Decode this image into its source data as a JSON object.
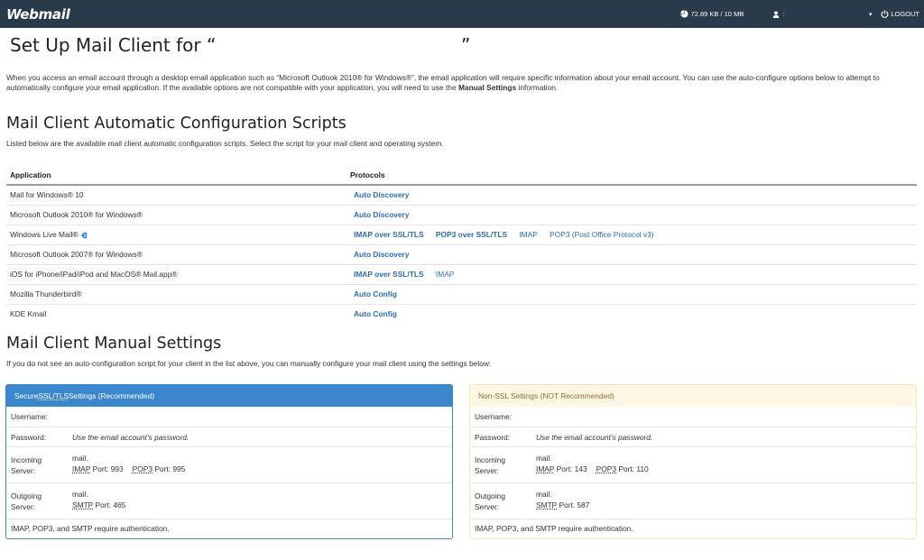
{
  "header": {
    "logo": "Webmail",
    "quota": "72.89 KB / 10 MB",
    "user": ":",
    "logout": "LOGOUT"
  },
  "page": {
    "title_open": "Set Up Mail Client for “",
    "title_close": "”",
    "intro_part1": "When you access an email account through a desktop email application such as “Microsoft Outlook 2010® for Windows®”, the email application will require specific information about your email account. You can use the auto-configure options below to attempt to automatically configure your email application. If the available options are not compatible with your application, you will need to use the ",
    "intro_bold": "Manual Settings",
    "intro_part2": " information."
  },
  "auto": {
    "heading": "Mail Client Automatic Configuration Scripts",
    "subtext": "Listed below are the available mail client automatic configuration scripts. Select the script for your mail client and operating system.",
    "col_application": "Application",
    "col_protocols": "Protocols",
    "rows": [
      {
        "app": "Mail for Windows® 10",
        "links": [
          "Auto Discovery"
        ]
      },
      {
        "app": "Microsoft Outlook 2010® for Windows®",
        "links": [
          "Auto Discovery"
        ]
      },
      {
        "app": "Windows Live Mail®",
        "links": [
          "IMAP over SSL/TLS",
          "POP3 over SSL/TLS",
          "IMAP",
          "POP3 (Post Office Protocol v3)"
        ]
      },
      {
        "app": "Microsoft Outlook 2007® for Windows®",
        "links": [
          "Auto Discovery"
        ]
      },
      {
        "app": "iOS for iPhone/iPad/iPod and MacOS® Mail.app®",
        "links": [
          "IMAP over SSL/TLS",
          "IMAP"
        ]
      },
      {
        "app": "Mozilla Thunderbird®",
        "links": [
          "Auto Config"
        ]
      },
      {
        "app": "KDE Kmail",
        "links": [
          "Auto Config"
        ]
      }
    ]
  },
  "manual": {
    "heading": "Mail Client Manual Settings",
    "subtext": "If you do not see an auto-configuration script for your client in the list above, you can manually configure your mail client using the settings below:",
    "secure": {
      "title_pre": "Secure ",
      "title_abbr": "SSL/TLS",
      "title_post": " Settings (Recommended)",
      "username_label": "Username:",
      "password_label": "Password:",
      "password_value": "Use the email account’s password.",
      "incoming_label_1": "Incoming",
      "incoming_label_2": "Server:",
      "incoming_host": "mail.",
      "incoming_imap": "IMAP",
      "incoming_imap_port": " Port: 993",
      "incoming_pop3": "POP3",
      "incoming_pop3_port": " Port: 995",
      "outgoing_label_1": "Outgoing",
      "outgoing_label_2": "Server:",
      "outgoing_host": "mail.",
      "outgoing_smtp": "SMTP",
      "outgoing_smtp_port": " Port: 465",
      "auth_note": "IMAP, POP3, and SMTP require authentication."
    },
    "nonssl": {
      "title": "Non-SSL Settings (NOT Recommended)",
      "username_label": "Username:",
      "password_label": "Password:",
      "password_value": "Use the email account’s password.",
      "incoming_label_1": "Incoming",
      "incoming_label_2": "Server:",
      "incoming_host": "mail.",
      "incoming_imap": "IMAP",
      "incoming_imap_port": " Port: 143",
      "incoming_pop3": "POP3",
      "incoming_pop3_port": " Port: 110",
      "outgoing_label_1": "Outgoing",
      "outgoing_label_2": "Server:",
      "outgoing_host": "mail.",
      "outgoing_smtp": "SMTP",
      "outgoing_smtp_port": " Port: 587",
      "auth_note": "IMAP, POP3, and SMTP require authentication."
    }
  },
  "colors": {
    "topbar": "#293a4a",
    "link": "#2a6db4",
    "secure_panel": "#3a87cc",
    "nonssl_panel_bg": "#fdf7e3",
    "nonssl_panel_text": "#8a6d3b"
  }
}
